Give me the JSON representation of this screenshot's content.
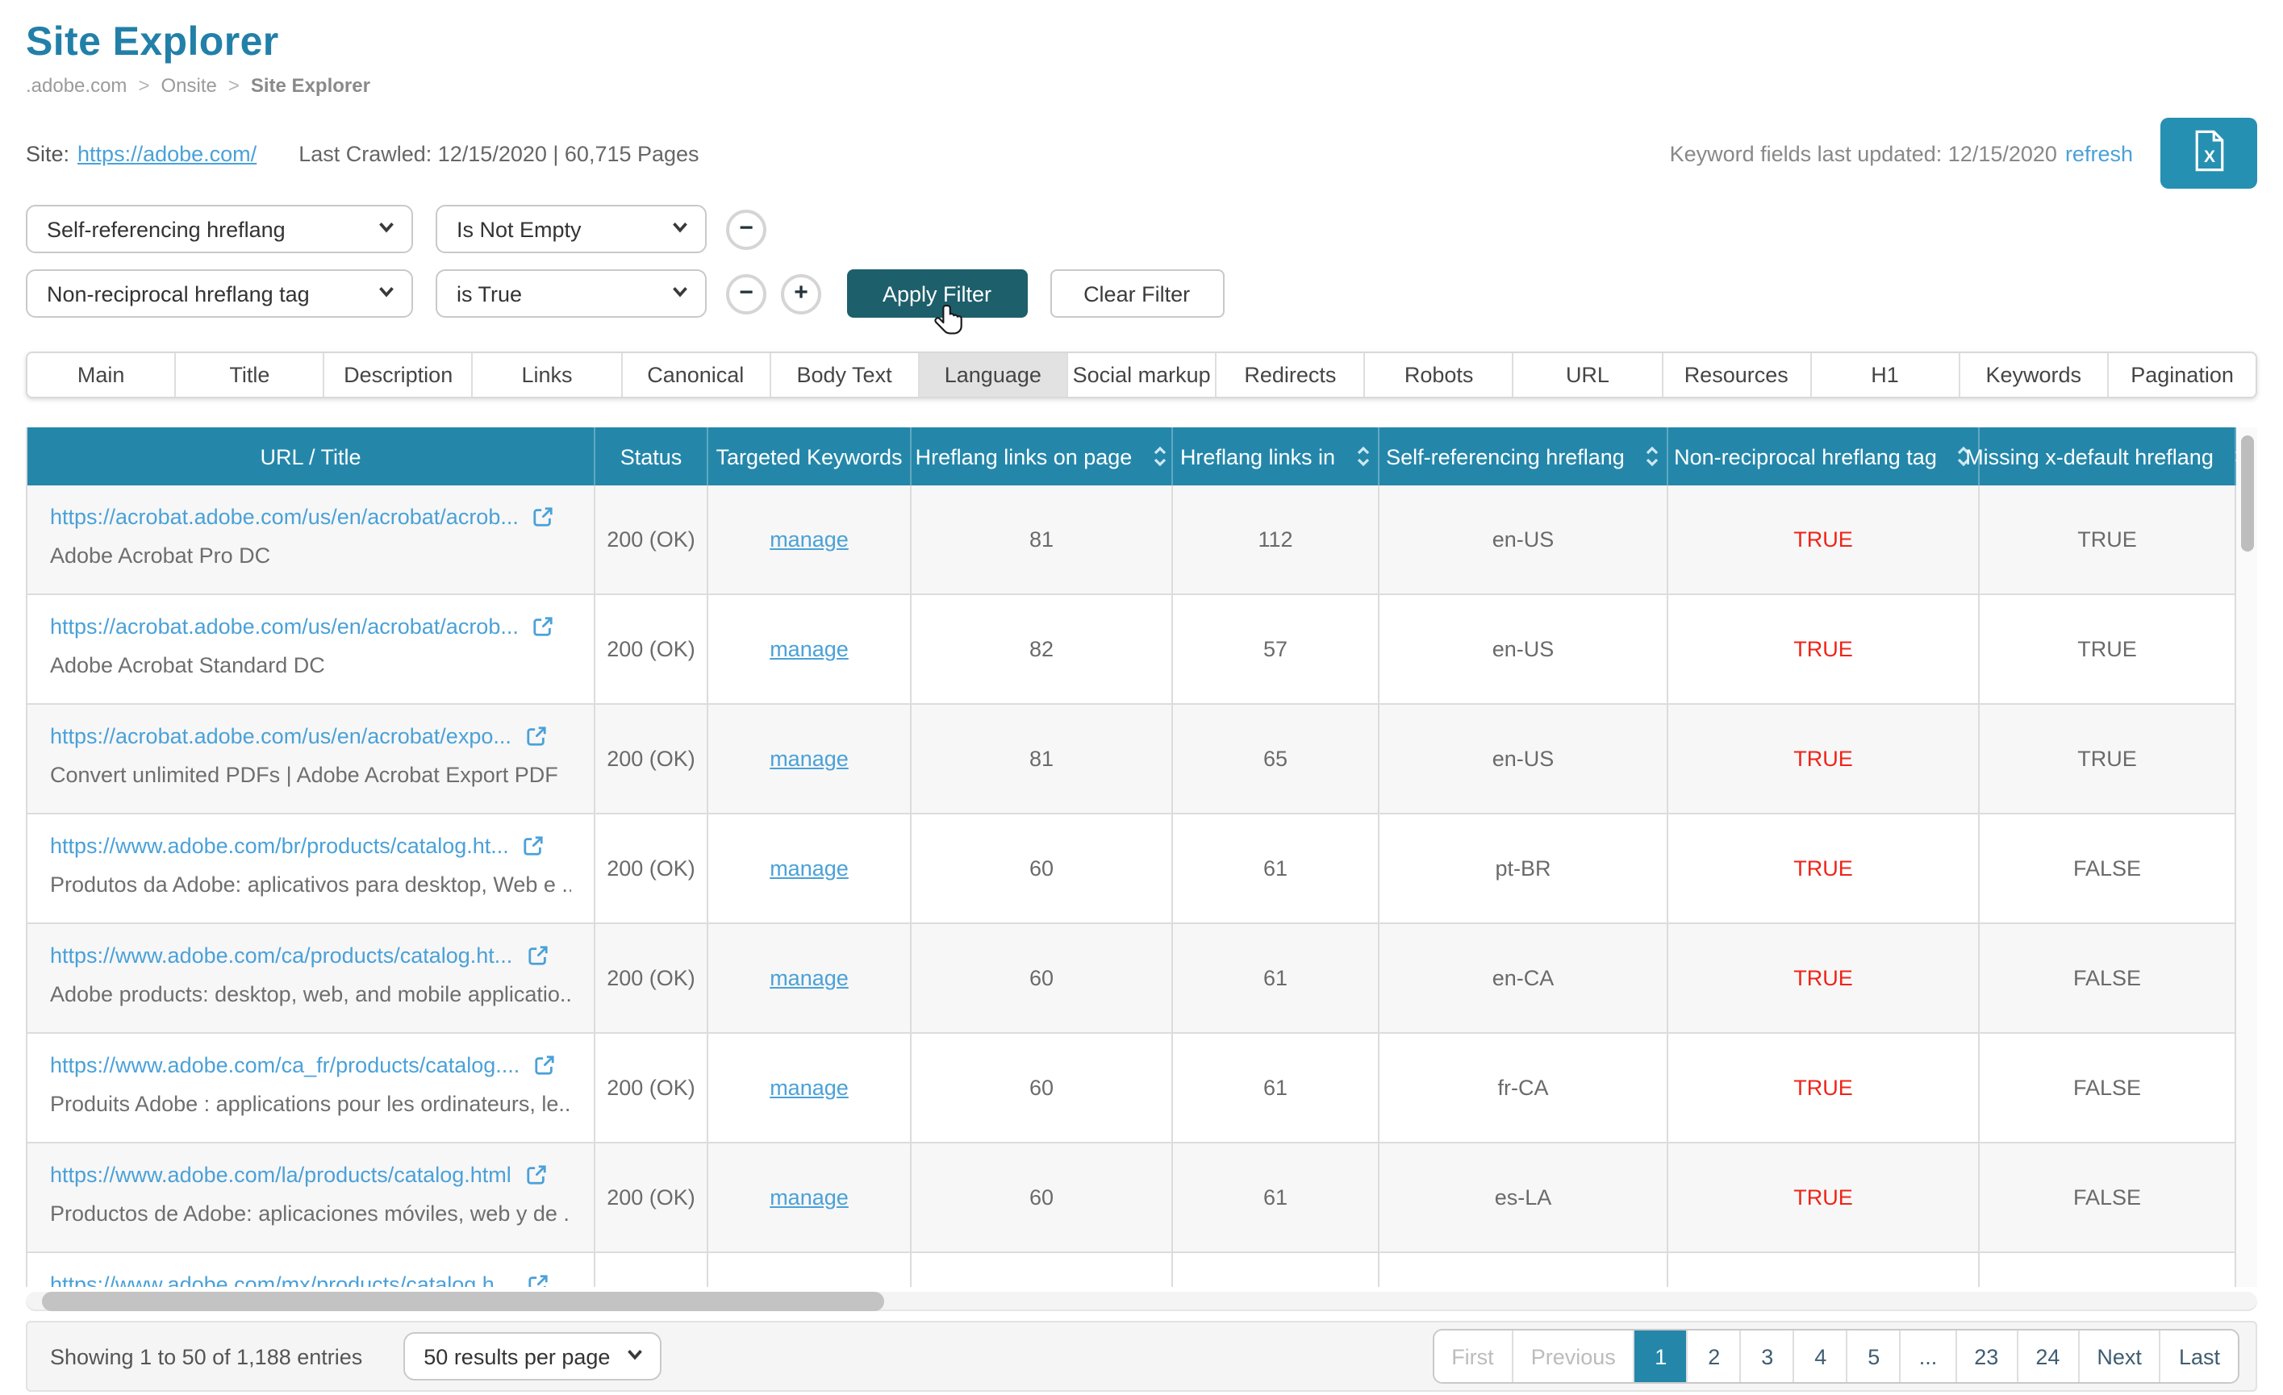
{
  "page": {
    "title": "Site Explorer",
    "breadcrumb": [
      ".adobe.com",
      "Onsite",
      "Site Explorer"
    ]
  },
  "site_bar": {
    "site_label": "Site:",
    "site_url": "https://adobe.com/",
    "crawl_info": "Last Crawled: 12/15/2020 | 60,715 Pages",
    "keyword_fields_text": "Keyword fields last updated: 12/15/2020",
    "refresh_label": "refresh",
    "export_icon": "excel-export-icon"
  },
  "filters": {
    "rows": [
      {
        "field": "Self-referencing hreflang",
        "operator": "Is Not Empty"
      },
      {
        "field": "Non-reciprocal hreflang tag",
        "operator": "is True"
      }
    ],
    "remove_icon": "minus-circle-icon",
    "add_icon": "plus-circle-icon",
    "apply_label": "Apply Filter",
    "clear_label": "Clear Filter"
  },
  "tabs": {
    "active": "Language",
    "items": [
      "Main",
      "Title",
      "Description",
      "Links",
      "Canonical",
      "Body Text",
      "Language",
      "Social markup",
      "Redirects",
      "Robots",
      "URL",
      "Resources",
      "H1",
      "Keywords",
      "Pagination"
    ]
  },
  "table": {
    "columns": [
      {
        "label": "URL / Title",
        "sortable": false
      },
      {
        "label": "Status",
        "sortable": false
      },
      {
        "label": "Targeted Keywords",
        "sortable": false
      },
      {
        "label": "Hreflang links on page",
        "sortable": true
      },
      {
        "label": "Hreflang links in",
        "sortable": true
      },
      {
        "label": "Self-referencing hreflang",
        "sortable": true
      },
      {
        "label": "Non-reciprocal hreflang tag",
        "sortable": true
      },
      {
        "label": "Missing x-default hreflang",
        "sortable": true
      }
    ],
    "rows": [
      {
        "url": "https://acrobat.adobe.com/us/en/acrobat/acrob...",
        "title": "Adobe Acrobat Pro DC",
        "status": "200 (OK)",
        "keywords": "manage",
        "links_on_page": "81",
        "links_in": "112",
        "self_ref": "en-US",
        "non_reciprocal": "TRUE",
        "missing_xdefault": "TRUE"
      },
      {
        "url": "https://acrobat.adobe.com/us/en/acrobat/acrob...",
        "title": "Adobe Acrobat Standard DC",
        "status": "200 (OK)",
        "keywords": "manage",
        "links_on_page": "82",
        "links_in": "57",
        "self_ref": "en-US",
        "non_reciprocal": "TRUE",
        "missing_xdefault": "TRUE"
      },
      {
        "url": "https://acrobat.adobe.com/us/en/acrobat/expo...",
        "title": "Convert unlimited PDFs | Adobe Acrobat Export PDF",
        "status": "200 (OK)",
        "keywords": "manage",
        "links_on_page": "81",
        "links_in": "65",
        "self_ref": "en-US",
        "non_reciprocal": "TRUE",
        "missing_xdefault": "TRUE"
      },
      {
        "url": "https://www.adobe.com/br/products/catalog.ht...",
        "title": "Produtos da Adobe: aplicativos para desktop, Web e ...",
        "status": "200 (OK)",
        "keywords": "manage",
        "links_on_page": "60",
        "links_in": "61",
        "self_ref": "pt-BR",
        "non_reciprocal": "TRUE",
        "missing_xdefault": "FALSE"
      },
      {
        "url": "https://www.adobe.com/ca/products/catalog.ht...",
        "title": "Adobe products: desktop, web, and mobile applicatio...",
        "status": "200 (OK)",
        "keywords": "manage",
        "links_on_page": "60",
        "links_in": "61",
        "self_ref": "en-CA",
        "non_reciprocal": "TRUE",
        "missing_xdefault": "FALSE"
      },
      {
        "url": "https://www.adobe.com/ca_fr/products/catalog....",
        "title": "Produits Adobe : applications pour les ordinateurs, le...",
        "status": "200 (OK)",
        "keywords": "manage",
        "links_on_page": "60",
        "links_in": "61",
        "self_ref": "fr-CA",
        "non_reciprocal": "TRUE",
        "missing_xdefault": "FALSE"
      },
      {
        "url": "https://www.adobe.com/la/products/catalog.html",
        "title": "Productos de Adobe: aplicaciones móviles, web y de ...",
        "status": "200 (OK)",
        "keywords": "manage",
        "links_on_page": "60",
        "links_in": "61",
        "self_ref": "es-LA",
        "non_reciprocal": "TRUE",
        "missing_xdefault": "FALSE"
      },
      {
        "url": "https://www.adobe.com/mx/products/catalog.h...",
        "title": "",
        "status": "",
        "keywords": "",
        "links_on_page": "",
        "links_in": "",
        "self_ref": "",
        "non_reciprocal": "",
        "missing_xdefault": "",
        "clipped": true
      }
    ]
  },
  "footer": {
    "showing_text": "Showing 1 to 50 of 1,188 entries",
    "per_page_value": "50 results per page",
    "pagination": [
      "First",
      "Previous",
      "1",
      "2",
      "3",
      "4",
      "5",
      "...",
      "23",
      "24",
      "Next",
      "Last"
    ],
    "active_page": "1",
    "disabled_buttons": [
      "First",
      "Previous"
    ]
  },
  "colors": {
    "accent_teal": "#2487aa",
    "apply_button_teal": "#1d5f6b",
    "link_blue": "#4aa1d8",
    "alert_red": "#f02318",
    "title_teal": "#2280a8"
  }
}
